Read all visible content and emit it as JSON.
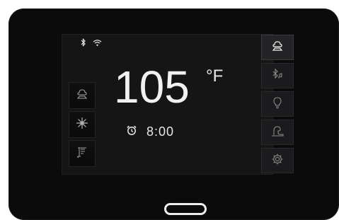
{
  "status": {
    "icons": [
      "bluetooth-icon",
      "wifi-icon"
    ]
  },
  "display": {
    "temperature": "105",
    "unit": "°F",
    "timer": "8:00"
  },
  "left_controls": [
    "steam-icon",
    "jets-icon",
    "shower-icon"
  ],
  "right_menu": [
    "heat-icon",
    "bluetooth-music-icon",
    "light-icon",
    "massage-icon",
    "settings-icon"
  ],
  "colors": {
    "device": "#0b0b0c",
    "screen": "#151516",
    "text": "#f1f1f1",
    "icon": "#9a9a9a",
    "active_icon": "#f0f0f0"
  }
}
